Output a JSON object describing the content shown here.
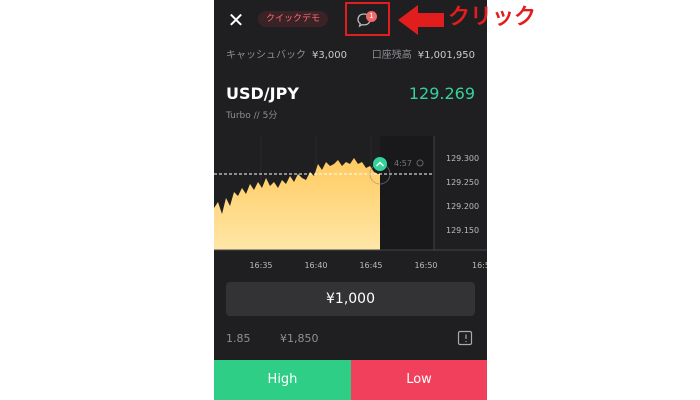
{
  "header": {
    "close_icon": "close-icon",
    "mode_label": "クイックデモ",
    "notification_icon": "chat-bubble-icon",
    "notification_count": "1"
  },
  "account": {
    "cashback_label": "キャッシュバック",
    "cashback_value": "¥3,000",
    "balance_label": "口座残高",
    "balance_value": "¥1,001,950"
  },
  "instrument": {
    "pair": "USD/JPY",
    "price": "129.269",
    "mode": "Turbo",
    "separator": "//",
    "duration": "5分"
  },
  "chart_data": {
    "type": "area",
    "x_ticks": [
      "16:35",
      "16:40",
      "16:45",
      "16:50",
      "16:5"
    ],
    "y_ticks": [
      "129.300",
      "129.250",
      "129.200",
      "129.150"
    ],
    "timer": "4:57",
    "colors": {
      "fill_top": "#ffca5f",
      "fill_bottom": "#ffe7a8",
      "price_line": "#ffffff",
      "marker": "#34d399"
    }
  },
  "trade": {
    "amount": "¥1,000",
    "payout_rate": "1.85",
    "payout_amount": "¥1,850",
    "calculator_icon": "calculator-icon",
    "high_label": "High",
    "low_label": "Low",
    "colors": {
      "high": "#2fce87",
      "low": "#f0405b"
    }
  },
  "annotation": {
    "label": "クリック",
    "color": "#e11d1d",
    "arrow_icon": "arrow-left-icon"
  }
}
